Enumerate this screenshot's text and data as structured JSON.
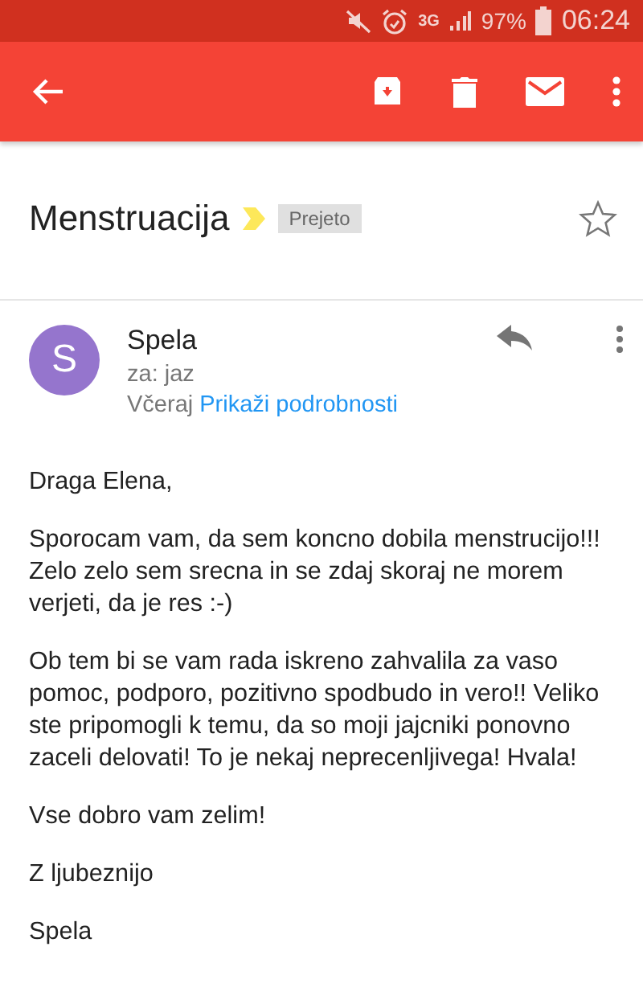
{
  "status_bar": {
    "network": "3G",
    "battery": "97%",
    "time": "06:24"
  },
  "subject": {
    "title": "Menstruacija",
    "important": true,
    "label": "Prejeto",
    "starred": false
  },
  "message": {
    "avatar_letter": "S",
    "sender": "Spela",
    "recipient": "za: jaz",
    "date": "Včeraj",
    "details_link": "Prikaži podrobnosti",
    "paragraphs": [
      "Draga Elena,",
      "Sporocam vam, da sem koncno dobila menstrucijo!!! Zelo zelo sem srecna in se zdaj skoraj ne morem verjeti, da je res :-)",
      "Ob tem bi se vam rada iskreno zahvalila za vaso pomoc, podporo, pozitivno spodbudo in vero!! Veliko ste pripomogli k temu, da so moji jajcniki ponovno zaceli delovati! To je nekaj neprecenljivega! Hvala!"
    ],
    "closing": [
      "Vse dobro vam zelim!",
      "Z ljubeznijo",
      "Spela"
    ]
  }
}
